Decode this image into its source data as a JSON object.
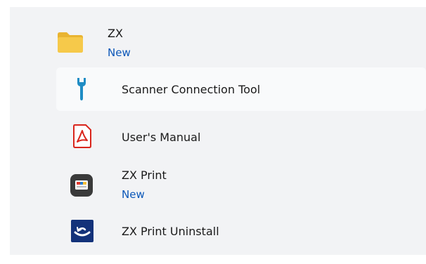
{
  "apps": [
    {
      "label": "ZX",
      "sub": "New",
      "icon": "folder-icon"
    },
    {
      "label": "Scanner Connection Tool",
      "icon": "wrench-icon"
    },
    {
      "label": "User's Manual",
      "icon": "pdf-icon"
    },
    {
      "label": "ZX Print",
      "sub": "New",
      "icon": "zx-print-icon"
    },
    {
      "label": "ZX Print Uninstall",
      "icon": "uninstall-icon"
    }
  ],
  "colors": {
    "panel_bg": "#f2f3f5",
    "hover_bg": "#f9fafb",
    "new_badge": "#0b57b8",
    "folder": "#f6c94a",
    "wrench": "#1e8cc4",
    "pdf": "#d9251c"
  }
}
